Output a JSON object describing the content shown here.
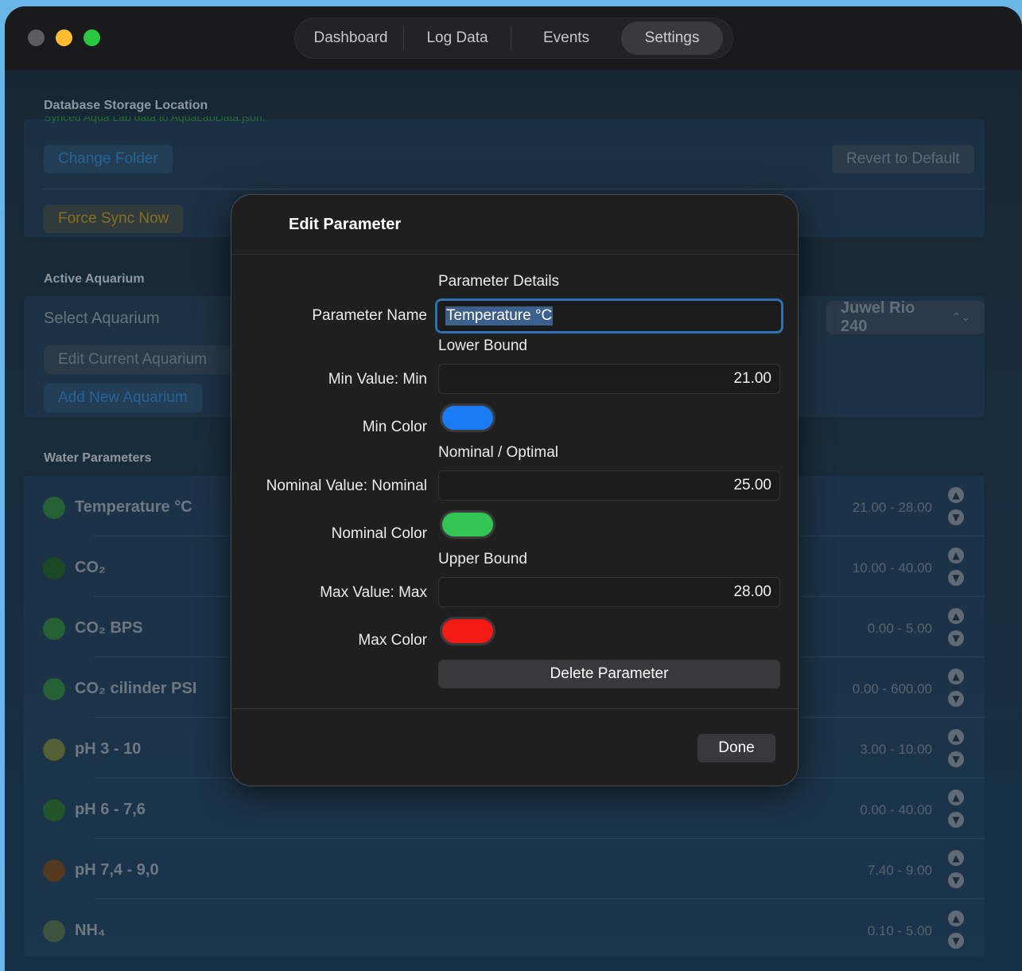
{
  "window": {
    "tabs": [
      {
        "label": "Dashboard"
      },
      {
        "label": "Log Data"
      },
      {
        "label": "Events"
      },
      {
        "label": "Settings"
      }
    ],
    "active_tab": "Settings"
  },
  "database": {
    "section_title": "Database Storage Location",
    "sync_status": "Synced Aqua Lab data to AquaLabData.json.",
    "change_folder_label": "Change Folder",
    "revert_label": "Revert to Default",
    "force_sync_label": "Force Sync Now"
  },
  "aquarium": {
    "section_title": "Active Aquarium",
    "select_label": "Select Aquarium",
    "selected_value": "Juwel Rio 240",
    "edit_label": "Edit Current Aquarium",
    "add_label": "Add New Aquarium"
  },
  "parameters": {
    "section_title": "Water Parameters",
    "items": [
      {
        "name": "Temperature °C",
        "range": "21.00 - 28.00",
        "dot_color": "#2f7a3c"
      },
      {
        "name": "CO₂",
        "range": "10.00 - 40.00",
        "dot_color": "#1f5a26"
      },
      {
        "name": "CO₂ BPS",
        "range": "0.00 - 5.00",
        "dot_color": "#2f7a3c"
      },
      {
        "name": "CO₂ cilinder PSI",
        "range": "0.00 - 600.00",
        "dot_color": "#2f7a3c"
      },
      {
        "name": "pH 3 - 10",
        "range": "3.00 - 10.00",
        "dot_color": "#6a7a3a"
      },
      {
        "name": "pH 6 - 7,6",
        "range": "0.00 - 40.00",
        "dot_color": "#2a6a2c"
      },
      {
        "name": "pH 7,4 - 9,0",
        "range": "7.40 - 9.00",
        "dot_color": "#6a4620"
      },
      {
        "name": "NH₄",
        "range": "0.10 - 5.00",
        "dot_color": "#4d6a48"
      }
    ]
  },
  "modal": {
    "title": "Edit Parameter",
    "details_header": "Parameter Details",
    "name_label": "Parameter Name",
    "name_value": "Temperature °C",
    "lower_header": "Lower Bound",
    "min_label": "Min Value:  Min",
    "min_value": "21.00",
    "min_color_label": "Min Color",
    "min_color": "#1a7cf5",
    "nominal_header": "Nominal / Optimal",
    "nominal_label": "Nominal Value:  Nominal",
    "nominal_value": "25.00",
    "nominal_color_label": "Nominal Color",
    "nominal_color": "#33c553",
    "upper_header": "Upper Bound",
    "max_label": "Max Value:  Max",
    "max_value": "28.00",
    "max_color_label": "Max Color",
    "max_color": "#f41a14",
    "delete_label": "Delete Parameter",
    "done_label": "Done"
  }
}
